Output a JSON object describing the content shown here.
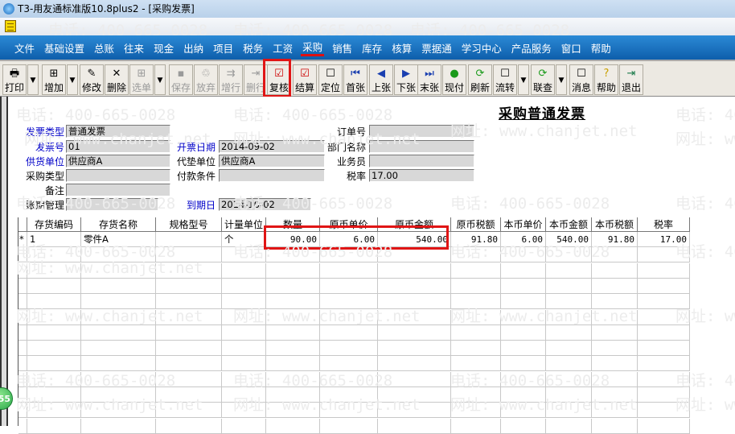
{
  "window": {
    "title": "T3-用友通标准版10.8plus2 - [采购发票]"
  },
  "menu": [
    "文件",
    "基础设置",
    "总账",
    "往来",
    "现金",
    "出纳",
    "项目",
    "税务",
    "工资",
    "采购",
    "销售",
    "库存",
    "核算",
    "票据通",
    "学习中心",
    "产品服务",
    "窗口",
    "帮助"
  ],
  "toolbar": [
    {
      "label": "打印",
      "icon": "printer-icon",
      "glyph": "🖶",
      "disabled": false,
      "dropdown": true
    },
    {
      "label": "增加",
      "icon": "add-icon",
      "glyph": "⊞",
      "disabled": false,
      "dropdown": true
    },
    {
      "label": "修改",
      "icon": "edit-icon",
      "glyph": "✎",
      "disabled": false
    },
    {
      "label": "删除",
      "icon": "delete-icon",
      "glyph": "✕",
      "disabled": false
    },
    {
      "label": "选单",
      "icon": "select-icon",
      "glyph": "⊞",
      "disabled": true,
      "dropdown": true
    },
    {
      "label": "保存",
      "icon": "save-icon",
      "glyph": "▪",
      "disabled": true
    },
    {
      "label": "放弃",
      "icon": "discard-icon",
      "glyph": "♲",
      "disabled": true
    },
    {
      "label": "增行",
      "icon": "add-row-icon",
      "glyph": "⇉",
      "disabled": true
    },
    {
      "label": "删行",
      "icon": "delete-row-icon",
      "glyph": "⇥",
      "disabled": true
    },
    {
      "label": "复核",
      "icon": "review-icon",
      "glyph": "☑",
      "disabled": false
    },
    {
      "label": "结算",
      "icon": "settle-icon",
      "glyph": "☑",
      "disabled": false
    },
    {
      "label": "定位",
      "icon": "locate-icon",
      "glyph": "☐",
      "disabled": false
    },
    {
      "label": "首张",
      "icon": "first-icon",
      "glyph": "⏮",
      "disabled": false
    },
    {
      "label": "上张",
      "icon": "prev-icon",
      "glyph": "◀",
      "disabled": false
    },
    {
      "label": "下张",
      "icon": "next-icon",
      "glyph": "▶",
      "disabled": false
    },
    {
      "label": "末张",
      "icon": "last-icon",
      "glyph": "⏭",
      "disabled": false
    },
    {
      "label": "现付",
      "icon": "cash-pay-icon",
      "glyph": "●",
      "disabled": false
    },
    {
      "label": "刷新",
      "icon": "refresh-icon",
      "glyph": "⟳",
      "disabled": false
    },
    {
      "label": "流转",
      "icon": "flow-icon",
      "glyph": "☐",
      "disabled": false,
      "dropdown": true
    },
    {
      "label": "联查",
      "icon": "query-icon",
      "glyph": "⟳",
      "disabled": false,
      "dropdown": true
    },
    {
      "label": "消息",
      "icon": "message-icon",
      "glyph": "☐",
      "disabled": false
    },
    {
      "label": "帮助",
      "icon": "help-icon",
      "glyph": "?",
      "disabled": false
    },
    {
      "label": "退出",
      "icon": "exit-icon",
      "glyph": "⇥",
      "disabled": false
    }
  ],
  "form": {
    "title": "采购普通发票",
    "invoice_type": {
      "label": "发票类型",
      "value": "普通发票"
    },
    "invoice_no": {
      "label": "发票号",
      "value": "01"
    },
    "invoice_date": {
      "label": "开票日期",
      "value": "2014-09-02"
    },
    "supplier": {
      "label": "供货单位",
      "value": "供应商A"
    },
    "advance_unit": {
      "label": "代垫单位",
      "value": "供应商A"
    },
    "purchase_type": {
      "label": "采购类型",
      "value": ""
    },
    "payment_terms": {
      "label": "付款条件",
      "value": ""
    },
    "remark": {
      "label": "备注",
      "value": ""
    },
    "term_mgmt": {
      "label": "账期管理",
      "value": ""
    },
    "due_date": {
      "label": "到期日",
      "value": "2014-10-02"
    },
    "order_no": {
      "label": "订单号",
      "value": ""
    },
    "department": {
      "label": "部门名称",
      "value": ""
    },
    "salesperson": {
      "label": "业务员",
      "value": ""
    },
    "tax_rate": {
      "label": "税率",
      "value": "17.00"
    }
  },
  "grid": {
    "columns": [
      "存货编码",
      "存货名称",
      "规格型号",
      "计量单位",
      "数量",
      "原币单价",
      "原币金额",
      "原币税额",
      "本币单价",
      "本币金额",
      "本币税额",
      "税率"
    ],
    "rows": [
      {
        "marker": "*",
        "cells": [
          "1",
          "零件A",
          "",
          "个",
          "90.00",
          "6.00",
          "540.00",
          "91.80",
          "6.00",
          "540.00",
          "91.80",
          "17.00"
        ]
      }
    ]
  },
  "watermark": {
    "phone": "电话: 400-665-0028",
    "site": "网址: www.chanjet.net"
  },
  "badge": "55",
  "colors": {
    "menubar": "#1a72c4",
    "highlight": "#e01515",
    "label_blue": "#0000c8"
  }
}
